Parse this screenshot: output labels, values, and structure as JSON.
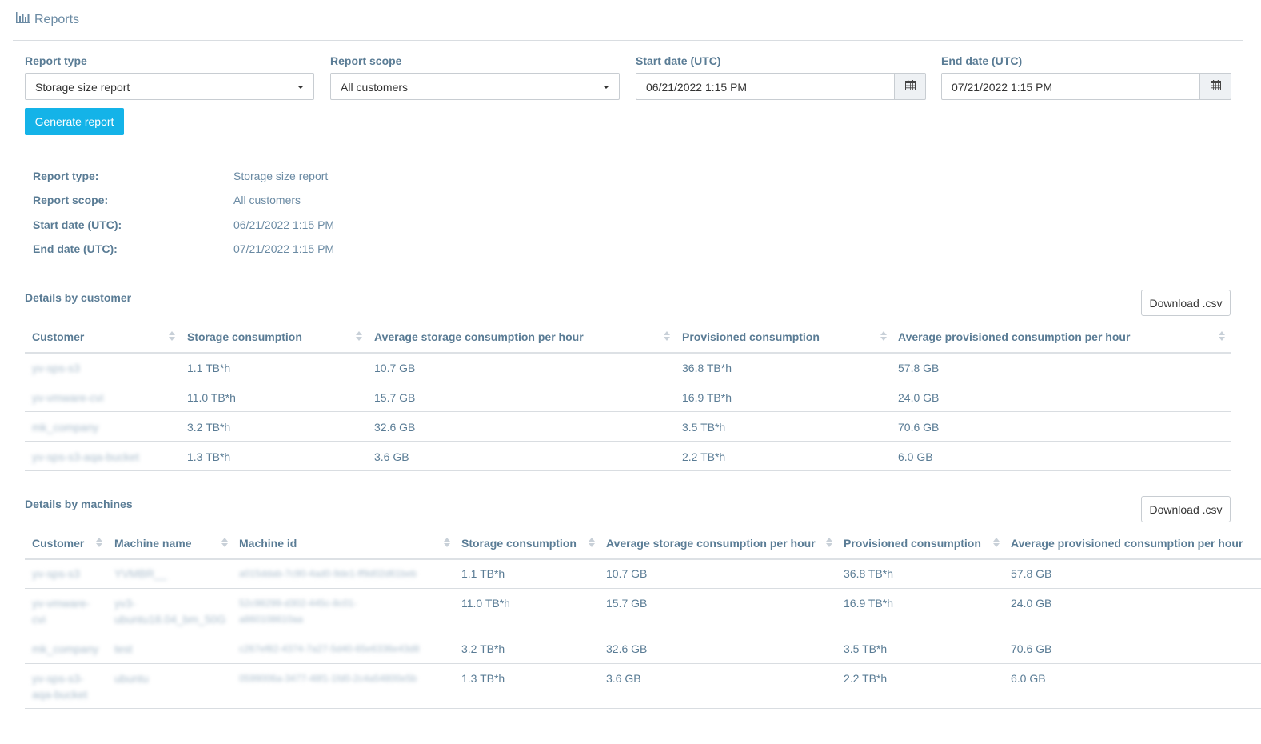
{
  "header": {
    "title": "Reports"
  },
  "form": {
    "report_type": {
      "label": "Report type",
      "value": "Storage size report"
    },
    "report_scope": {
      "label": "Report scope",
      "value": "All customers"
    },
    "start_date": {
      "label": "Start date (UTC)",
      "value": "06/21/2022 1:15 PM"
    },
    "end_date": {
      "label": "End date (UTC)",
      "value": "07/21/2022 1:15 PM"
    },
    "generate_label": "Generate report"
  },
  "summary": [
    {
      "key": "Report type:",
      "value": "Storage size report"
    },
    {
      "key": "Report scope:",
      "value": "All customers"
    },
    {
      "key": "Start date (UTC):",
      "value": "06/21/2022 1:15 PM"
    },
    {
      "key": "End date (UTC):",
      "value": "07/21/2022 1:15 PM"
    }
  ],
  "by_customer": {
    "title": "Details by customer",
    "download_label": "Download .csv",
    "columns": [
      "Customer",
      "Storage consumption",
      "Average storage consumption per hour",
      "Provisioned consumption",
      "Average provisioned consumption per hour"
    ],
    "rows": [
      [
        "yv-sps-s3",
        "1.1 TB*h",
        "10.7 GB",
        "36.8 TB*h",
        "57.8 GB"
      ],
      [
        "yv-vmware-cvi",
        "11.0 TB*h",
        "15.7 GB",
        "16.9 TB*h",
        "24.0 GB"
      ],
      [
        "mk_company",
        "3.2 TB*h",
        "32.6 GB",
        "3.5 TB*h",
        "70.6 GB"
      ],
      [
        "yv-sps-s3-aqa-bucket",
        "1.3 TB*h",
        "3.6 GB",
        "2.2 TB*h",
        "6.0 GB"
      ]
    ]
  },
  "by_machines": {
    "title": "Details by machines",
    "download_label": "Download .csv",
    "columns": [
      "Customer",
      "Machine name",
      "Machine id",
      "Storage consumption",
      "Average storage consumption per hour",
      "Provisioned consumption",
      "Average provisioned consumption per hour"
    ],
    "rows": [
      [
        "yv-sps-s3",
        "YVMBR__",
        "a015ddab-7c90-4ad0-9de1-ff9d02d61beb",
        "1.1 TB*h",
        "10.7 GB",
        "36.8 TB*h",
        "57.8 GB"
      ],
      [
        "yv-vmware-cvi",
        "yv3-ubuntu18.04_bm_50G",
        "52c98299-d302-445c-8c01-a860108610aa",
        "11.0 TB*h",
        "15.7 GB",
        "16.9 TB*h",
        "24.0 GB"
      ],
      [
        "mk_company",
        "test",
        "c267ef82-4374-7a27-5d40-65e6336e43d8",
        "3.2 TB*h",
        "32.6 GB",
        "3.5 TB*h",
        "70.6 GB"
      ],
      [
        "yv-sps-s3-aqa-bucket",
        "ubuntu",
        "0599006a-3477-48f1-1fd0-2c4a54800e5b",
        "1.3 TB*h",
        "3.6 GB",
        "2.2 TB*h",
        "6.0 GB"
      ]
    ]
  },
  "colors": {
    "accent": "#14b3e8",
    "text": "#5a7c95",
    "border": "#d9dde1"
  }
}
